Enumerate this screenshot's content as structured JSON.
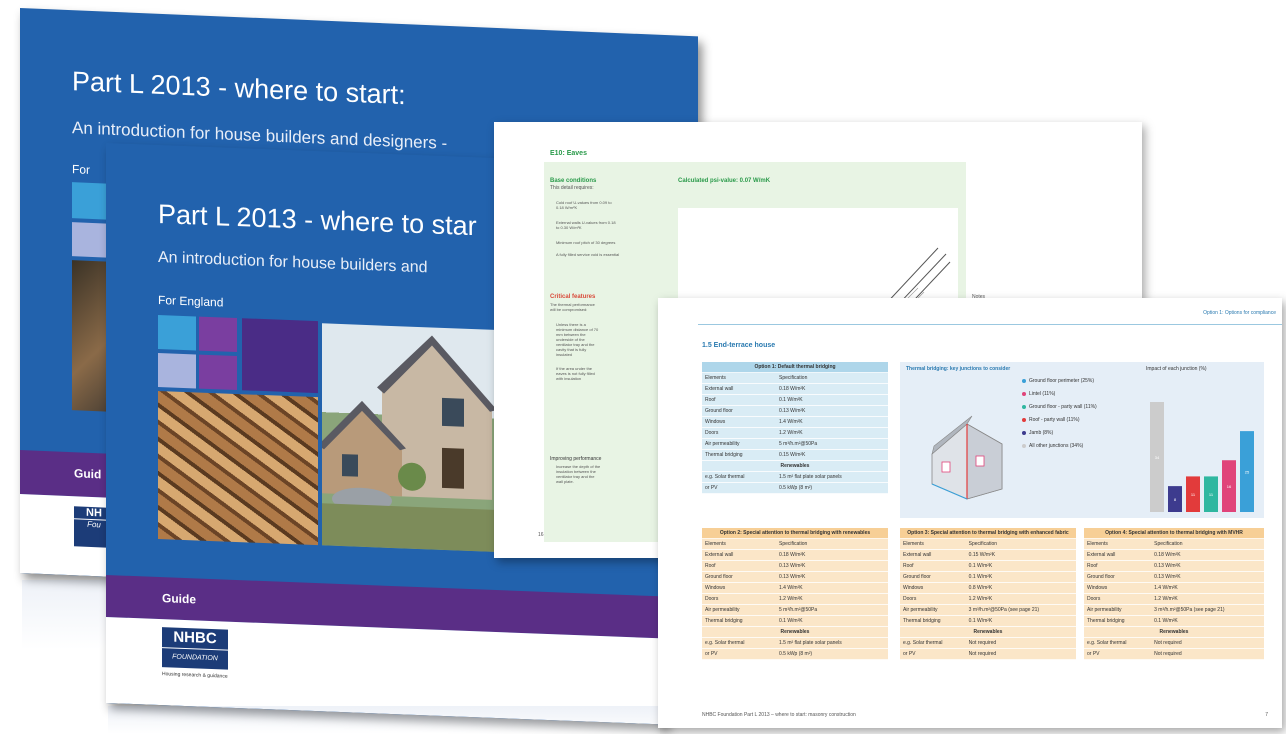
{
  "back_cover": {
    "title": "Part L 2013 - where to start:",
    "subtitle": "An introduction for house builders and designers -",
    "for_label": "For",
    "guide_label": "Guid"
  },
  "front_cover": {
    "title": "Part L 2013 - where to star",
    "subtitle": "An introduction for house builders and",
    "for_label": "For England",
    "guide_label": "Guide",
    "logo_top": "NHBC",
    "logo_bottom": "FOUNDATION",
    "tagline": "Housing research & guidance"
  },
  "colors": {
    "cover_blue": "#2262ad",
    "band_purple": "#5a2e86",
    "logo_navy": "#1c3c78",
    "tile_light_blue": "#3aa0d8",
    "tile_purple": "#7a3ea0",
    "tile_lavender": "#a9b4de"
  },
  "eaves_page": {
    "heading": "E10: Eaves",
    "base_title": "Base conditions",
    "base_intro": "This detail requires:",
    "psi_label": "Calculated psi-value: 0.07 W/mK",
    "bullets": [
      "Cold roof U-values from 0.09 to 0.18 W/m²K",
      "External walls U-values from 0.18 to 0.30 W/m²K",
      "Minimum roof pitch of 30 degrees",
      "A fully filled service void is essential"
    ],
    "critical_title": "Critical features",
    "critical_text": "The thermal performance will be compromised:",
    "critical_bullets": [
      "Unless there is a minimum distance of 70 mm between the underside of the ventilator tray and the cavity that is fully insulated",
      "If the area under the eaves is not fully filled with insulation"
    ],
    "improving_title": "Improving performance",
    "improving_text": "Increase the depth of the insulation between the ventilator tray and the wall plate.",
    "notes_label": "Notes",
    "page_number": "16"
  },
  "terrace_page": {
    "header_right": "Option 1: Options for compliance",
    "heading": "1.5 End-terrace house",
    "option1_title": "Option 1: Default thermal bridging",
    "col_elements": "Elements",
    "col_spec": "Specification",
    "option1_rows": [
      [
        "External wall",
        "0.18 W/m²K"
      ],
      [
        "Roof",
        "0.1 W/m²K"
      ],
      [
        "Ground floor",
        "0.13 W/m²K"
      ],
      [
        "Windows",
        "1.4 W/m²K"
      ],
      [
        "Doors",
        "1.2 W/m²K"
      ],
      [
        "Air permeability",
        "5 m³/h.m²@50Pa"
      ],
      [
        "Thermal bridging",
        "0.15 W/m²K"
      ]
    ],
    "renewables_label": "Renewables",
    "option1_renewables": [
      [
        "e.g. Solar thermal",
        "1.5 m² flat plate solar panels"
      ],
      [
        "or PV",
        "0.5 kWp (8 m²)"
      ]
    ],
    "bridging_title": "Thermal bridging: key junctions to consider",
    "impact_title": "Impact of each junction (%)",
    "legend": [
      {
        "label": "Ground floor perimeter (25%)",
        "color": "#3aa0d8"
      },
      {
        "label": "Lintel (11%)",
        "color": "#e0447a"
      },
      {
        "label": "Ground floor - party wall (11%)",
        "color": "#2fb7a0"
      },
      {
        "label": "Roof - party wall (11%)",
        "color": "#e23b3b"
      },
      {
        "label": "Jamb (8%)",
        "color": "#3d3b8e"
      },
      {
        "label": "All other junctions (34%)",
        "color": "#cccccc"
      }
    ],
    "impact_bars": [
      {
        "value": 34,
        "label": "34",
        "color": "#cccccc"
      },
      {
        "value": 8,
        "label": "8",
        "color": "#3d3b8e"
      },
      {
        "value": 11,
        "label": "11",
        "color": "#e23b3b"
      },
      {
        "value": 11,
        "label": "11",
        "color": "#2fb7a0"
      },
      {
        "value": 16,
        "label": "16",
        "color": "#e0447a"
      },
      {
        "value": 25,
        "label": "25",
        "color": "#3aa0d8"
      }
    ],
    "option2_title": "Option 2: Special attention to thermal bridging with renewables",
    "option2_rows": [
      [
        "External wall",
        "0.18 W/m²K"
      ],
      [
        "Roof",
        "0.13 W/m²K"
      ],
      [
        "Ground floor",
        "0.13 W/m²K"
      ],
      [
        "Windows",
        "1.4 W/m²K"
      ],
      [
        "Doors",
        "1.2 W/m²K"
      ],
      [
        "Air permeability",
        "5 m³/h.m²@50Pa"
      ],
      [
        "Thermal bridging",
        "0.1 W/m²K"
      ]
    ],
    "option2_renewables": [
      [
        "e.g. Solar thermal",
        "1.5 m² flat plate solar panels"
      ],
      [
        "or PV",
        "0.5 kWp (8 m²)"
      ]
    ],
    "option3_title": "Option 3: Special attention to thermal bridging with enhanced fabric",
    "option3_rows": [
      [
        "External wall",
        "0.15 W/m²K"
      ],
      [
        "Roof",
        "0.1 W/m²K"
      ],
      [
        "Ground floor",
        "0.1 W/m²K"
      ],
      [
        "Windows",
        "0.8 W/m²K"
      ],
      [
        "Doors",
        "1.2 W/m²K"
      ],
      [
        "Air permeability",
        "3 m³/h.m²@50Pa (see page 21)"
      ],
      [
        "Thermal bridging",
        "0.1 W/m²K"
      ]
    ],
    "option3_renewables": [
      [
        "e.g. Solar thermal",
        "Not required"
      ],
      [
        "or PV",
        "Not required"
      ]
    ],
    "option4_title": "Option 4: Special attention to thermal bridging with MVHR",
    "option4_rows": [
      [
        "External wall",
        "0.18 W/m²K"
      ],
      [
        "Roof",
        "0.13 W/m²K"
      ],
      [
        "Ground floor",
        "0.13 W/m²K"
      ],
      [
        "Windows",
        "1.4 W/m²K"
      ],
      [
        "Doors",
        "1.2 W/m²K"
      ],
      [
        "Air permeability",
        "3 m³/h.m²@50Pa (see page 21)"
      ],
      [
        "Thermal bridging",
        "0.1 W/m²K"
      ]
    ],
    "option4_renewables": [
      [
        "e.g. Solar thermal",
        "Not required"
      ],
      [
        "or PV",
        "Not required"
      ]
    ],
    "footer_left": "NHBC Foundation Part L 2013 – where to start: masonry construction",
    "page_number": "7"
  }
}
